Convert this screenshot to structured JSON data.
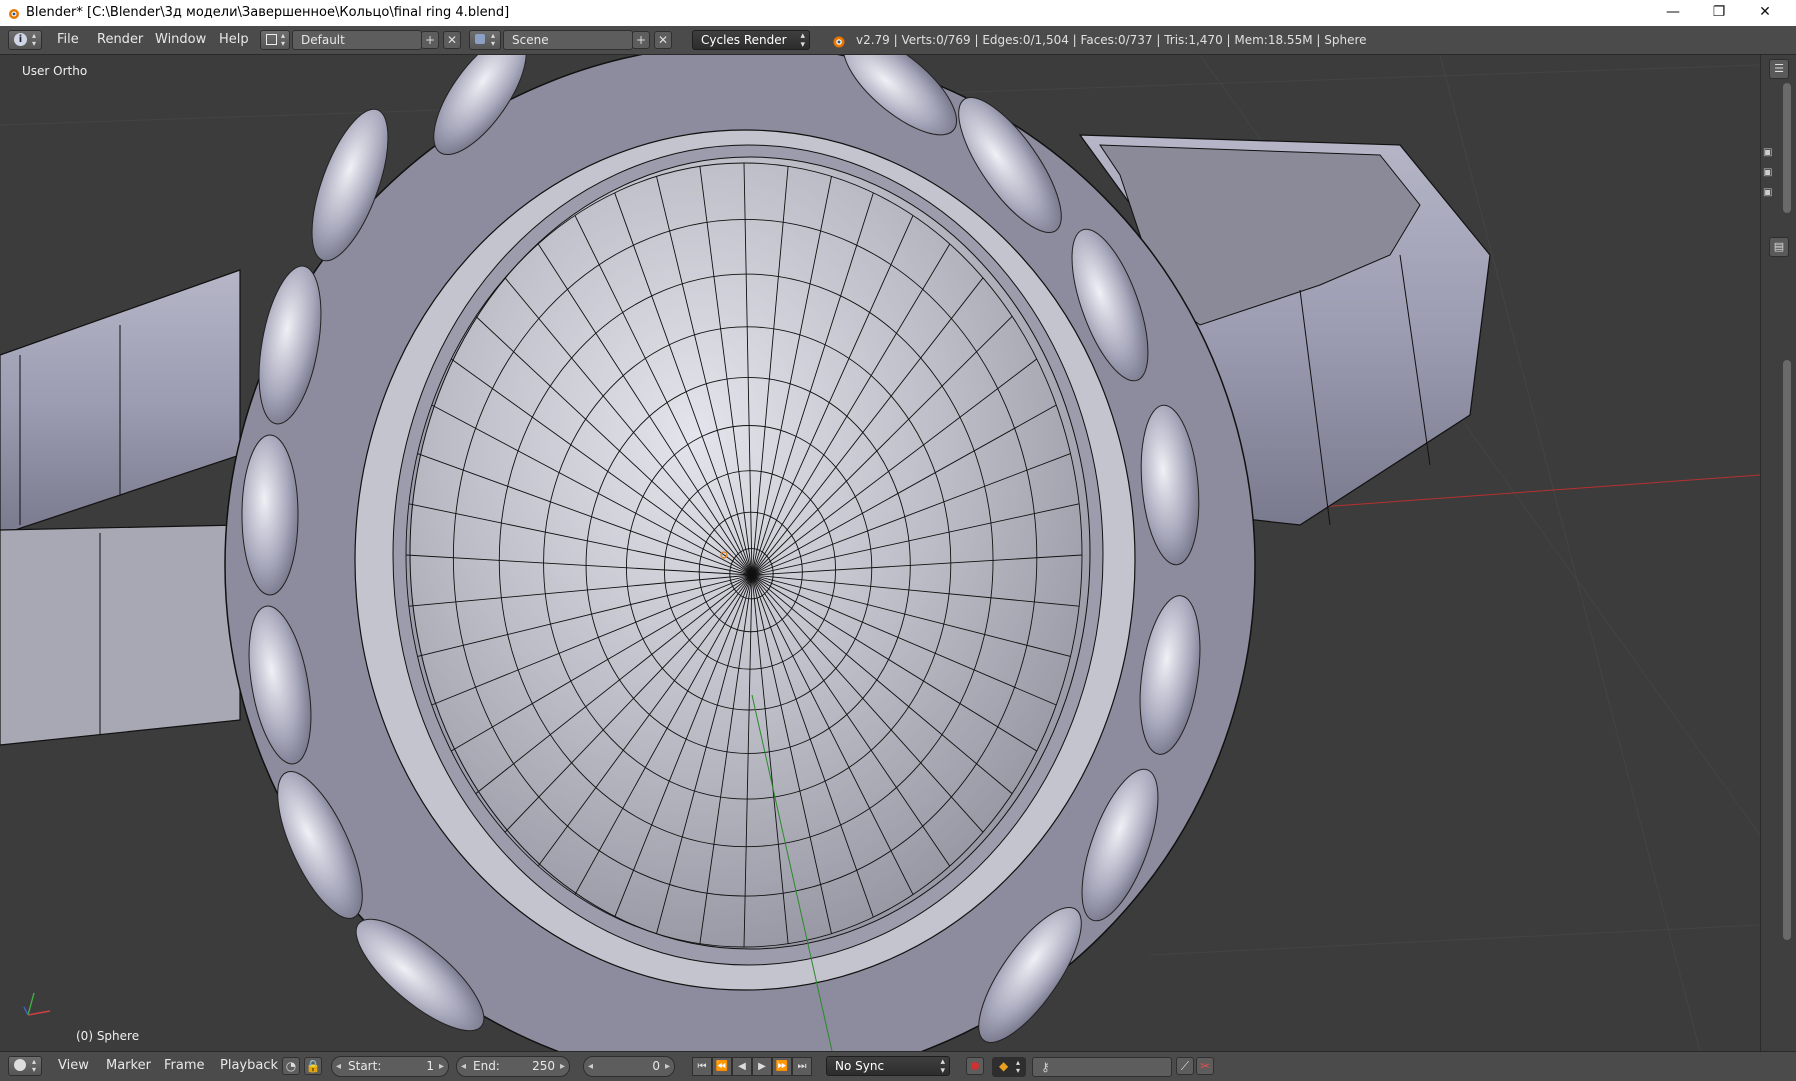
{
  "window": {
    "title": "Blender* [C:\\Blender\\3д модели\\Завершенное\\Кольцо\\final ring  4.blend]",
    "buttons": {
      "minimize": "—",
      "maximize": "❐",
      "close": "✕"
    }
  },
  "info_header": {
    "editor_icon": "info-icon",
    "menus": [
      "File",
      "Render",
      "Window",
      "Help"
    ],
    "screen_layout": "Default",
    "scene": "Scene",
    "render_engine": "Cycles Render",
    "stats": "v2.79 | Verts:0/769 | Edges:0/1,504 | Faces:0/737 | Tris:1,470 | Mem:18.55M | Sphere"
  },
  "viewport": {
    "view_name": "User Ortho",
    "object_info": "(0) Sphere"
  },
  "timeline": {
    "menus": [
      "View",
      "Marker",
      "Frame",
      "Playback"
    ],
    "start_label": "Start:",
    "start_value": "1",
    "end_label": "End:",
    "end_value": "250",
    "current_frame": "0",
    "sync_mode": "No Sync"
  },
  "colors": {
    "accent_orange": "#e87d0d",
    "header_bg": "#4b4b4b",
    "viewport_bg": "#3c3c3c",
    "mesh_color": "#b8b8c8",
    "x_axis": "#c03030",
    "y_axis": "#30a030"
  }
}
